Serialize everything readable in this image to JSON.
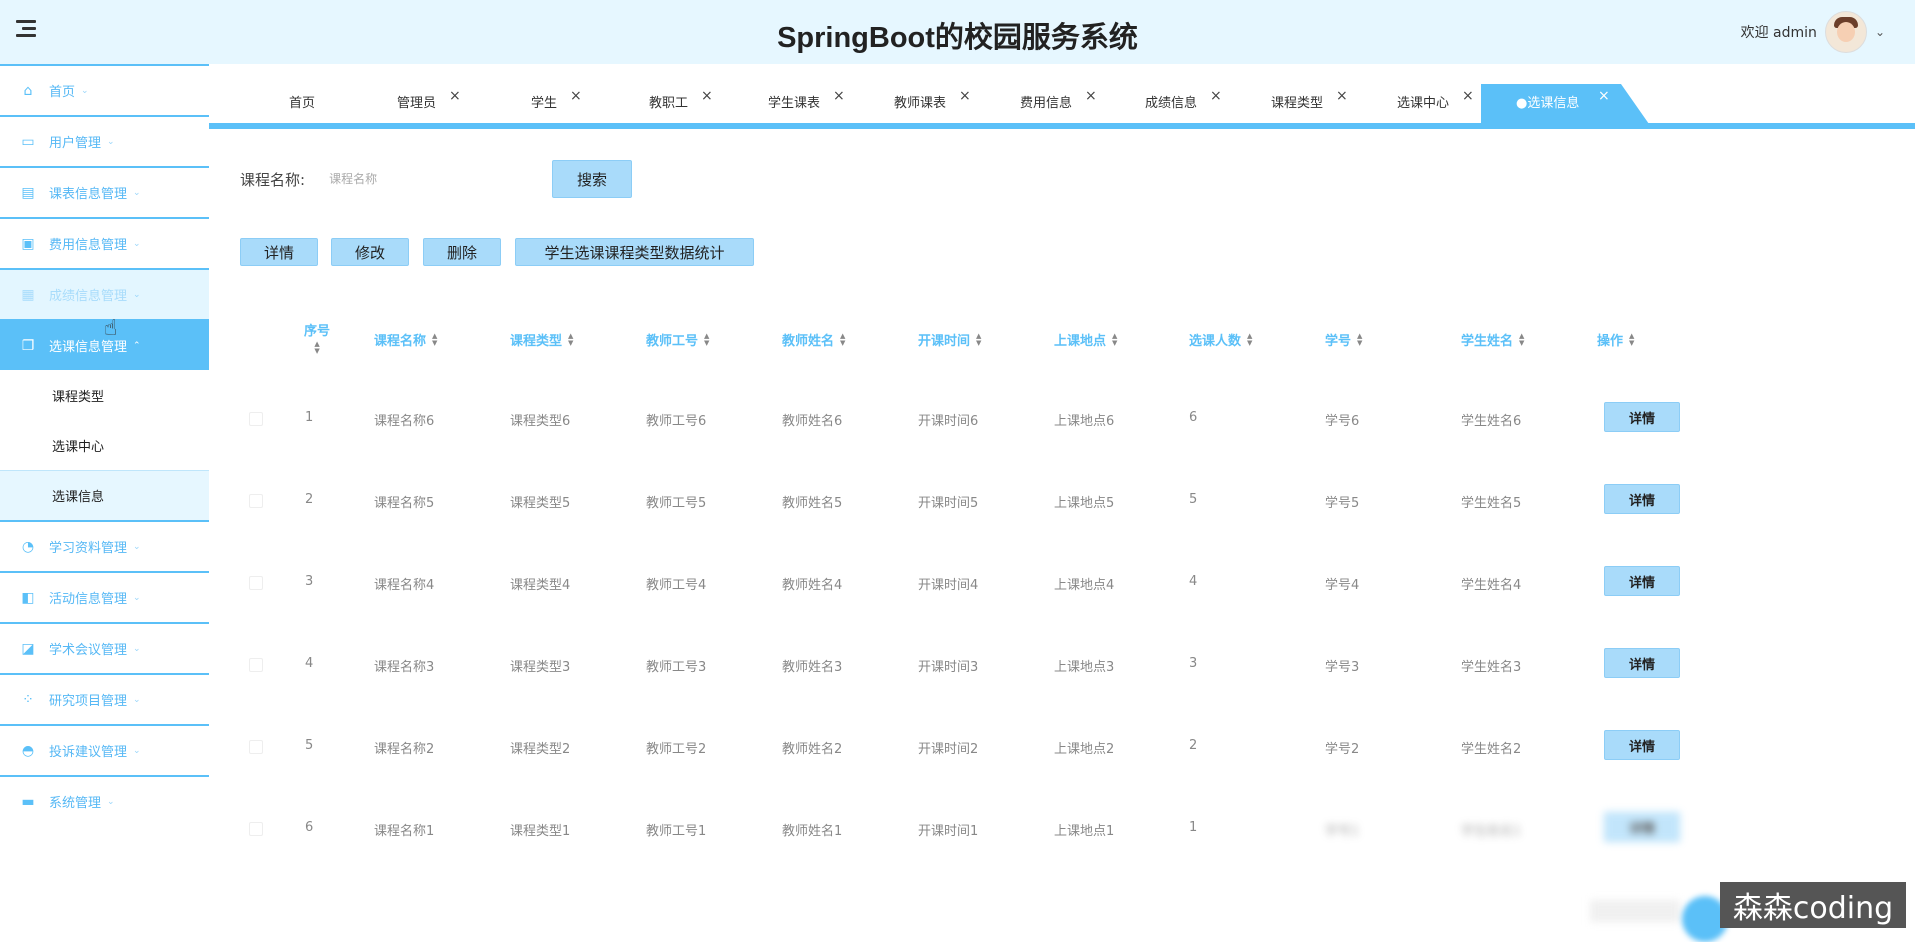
{
  "app_title": "SpringBoot的校园服务系统",
  "user": {
    "welcome": "欢迎 admin"
  },
  "sidebar": {
    "items": [
      {
        "label": "首页",
        "icon": "home-icon"
      },
      {
        "label": "用户管理",
        "icon": "user-card-icon"
      },
      {
        "label": "课表信息管理",
        "icon": "archive-icon"
      },
      {
        "label": "费用信息管理",
        "icon": "wallet-icon"
      },
      {
        "label": "成绩信息管理",
        "icon": "table-icon"
      },
      {
        "label": "选课信息管理",
        "icon": "documents-icon"
      },
      {
        "label": "学习资料管理",
        "icon": "pie-chart-icon"
      },
      {
        "label": "活动信息管理",
        "icon": "panel-icon"
      },
      {
        "label": "学术会议管理",
        "icon": "note-icon"
      },
      {
        "label": "研究项目管理",
        "icon": "grid-icon"
      },
      {
        "label": "投诉建议管理",
        "icon": "incognito-icon"
      },
      {
        "label": "系统管理",
        "icon": "card-icon"
      }
    ],
    "sub_items": [
      "课程类型",
      "选课中心",
      "选课信息"
    ]
  },
  "tabs": [
    "首页",
    "管理员",
    "学生",
    "教职工",
    "学生课表",
    "教师课表",
    "费用信息",
    "成绩信息",
    "课程类型",
    "选课中心",
    "●选课信息"
  ],
  "search": {
    "label": "课程名称:",
    "placeholder": "课程名称",
    "button": "搜索"
  },
  "actions": {
    "detail": "详情",
    "edit": "修改",
    "delete": "删除",
    "stats": "学生选课课程类型数据统计"
  },
  "table": {
    "headers": [
      "序号",
      "课程名称",
      "课程类型",
      "教师工号",
      "教师姓名",
      "开课时间",
      "上课地点",
      "选课人数",
      "学号",
      "学生姓名",
      "操作"
    ],
    "rows": [
      [
        "1",
        "课程名称6",
        "课程类型6",
        "教师工号6",
        "教师姓名6",
        "开课时间6",
        "上课地点6",
        "6",
        "学号6",
        "学生姓名6"
      ],
      [
        "2",
        "课程名称5",
        "课程类型5",
        "教师工号5",
        "教师姓名5",
        "开课时间5",
        "上课地点5",
        "5",
        "学号5",
        "学生姓名5"
      ],
      [
        "3",
        "课程名称4",
        "课程类型4",
        "教师工号4",
        "教师姓名4",
        "开课时间4",
        "上课地点4",
        "4",
        "学号4",
        "学生姓名4"
      ],
      [
        "4",
        "课程名称3",
        "课程类型3",
        "教师工号3",
        "教师姓名3",
        "开课时间3",
        "上课地点3",
        "3",
        "学号3",
        "学生姓名3"
      ],
      [
        "5",
        "课程名称2",
        "课程类型2",
        "教师工号2",
        "教师姓名2",
        "开课时间2",
        "上课地点2",
        "2",
        "学号2",
        "学生姓名2"
      ],
      [
        "6",
        "课程名称1",
        "课程类型1",
        "教师工号1",
        "教师姓名1",
        "开课时间1",
        "上课地点1",
        "1",
        "学号1",
        "学生姓名1"
      ]
    ],
    "row_button": "详情"
  },
  "watermark": "森森coding"
}
